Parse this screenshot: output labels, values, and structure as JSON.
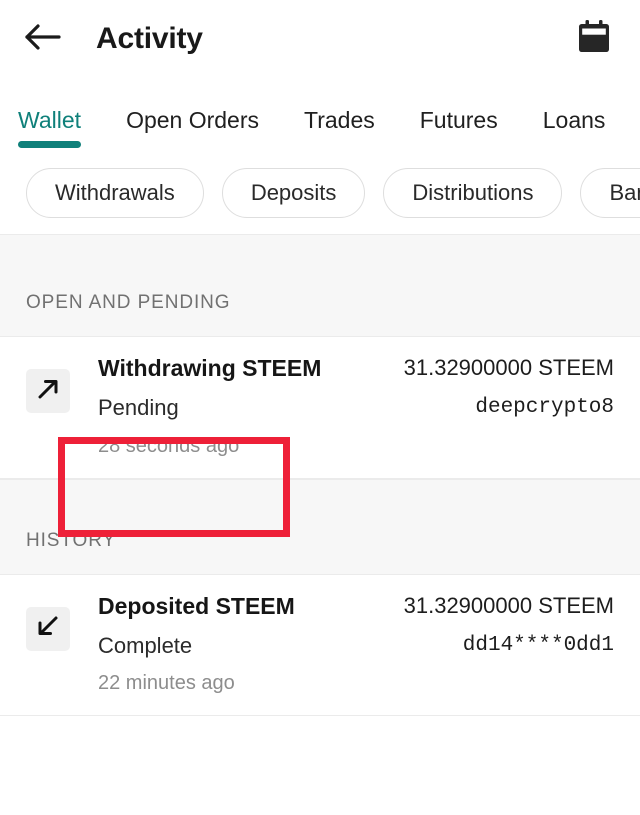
{
  "header": {
    "back_icon": "arrow-left-icon",
    "title": "Activity",
    "calendar_icon": "calendar-icon"
  },
  "tabs": [
    {
      "label": "Wallet",
      "active": true
    },
    {
      "label": "Open Orders",
      "active": false
    },
    {
      "label": "Trades",
      "active": false
    },
    {
      "label": "Futures",
      "active": false
    },
    {
      "label": "Loans",
      "active": false
    }
  ],
  "filter_chips": [
    {
      "label": "Withdrawals"
    },
    {
      "label": "Deposits"
    },
    {
      "label": "Distributions"
    },
    {
      "label": "Bank"
    }
  ],
  "sections": [
    {
      "heading": "OPEN AND PENDING",
      "rows": [
        {
          "icon": "arrow-up-right-icon",
          "title": "Withdrawing STEEM",
          "status": "Pending",
          "time": "28 seconds ago",
          "amount": "31.32900000 STEEM",
          "destination": "deepcrypto8"
        }
      ]
    },
    {
      "heading": "HISTORY",
      "rows": [
        {
          "icon": "arrow-down-left-icon",
          "title": "Deposited STEEM",
          "status": "Complete",
          "time": "22 minutes ago",
          "amount": "31.32900000 STEEM",
          "destination": "dd14****0dd1"
        }
      ]
    }
  ],
  "annotation": {
    "name": "red-highlight-box",
    "color": "#ee2038"
  },
  "colors": {
    "accent_teal": "#0f807a",
    "text_primary": "#1b1b1b",
    "text_muted": "#8d8d8d",
    "section_bg": "#f7f7f7",
    "divider": "#ebebeb"
  }
}
